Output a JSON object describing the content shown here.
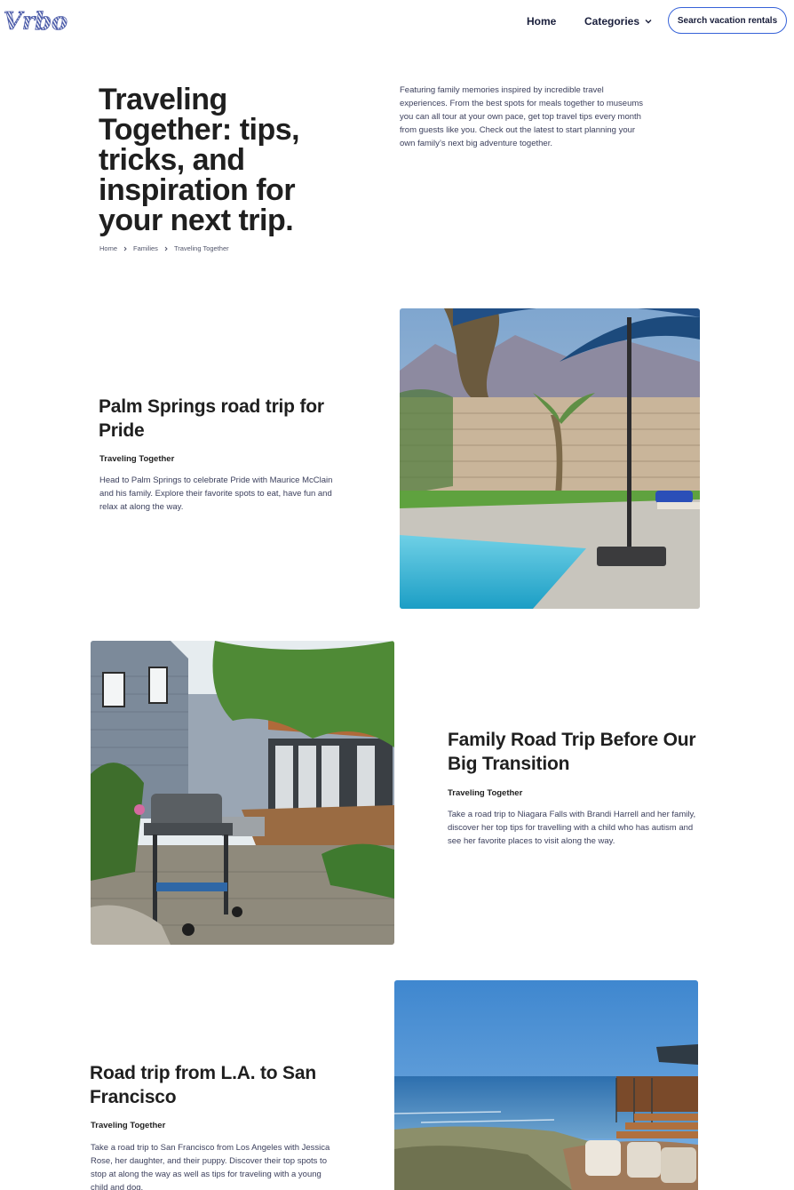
{
  "header": {
    "logo_text": "Vrbo",
    "nav_home": "Home",
    "nav_categories": "Categories",
    "search_button": "Search vacation rentals"
  },
  "hero": {
    "title": "Traveling Together: tips, tricks, and inspiration for your next trip.",
    "description": "Featuring family memories inspired by incredible travel experiences. From the best spots for meals together to museums you can all tour at your own pace, get top travel tips every month from guests like you. Check out the latest to start planning your own family’s next big adventure together.",
    "breadcrumb": [
      "Home",
      "Families",
      "Traveling Together"
    ]
  },
  "articles": [
    {
      "title": "Palm Springs road trip for Pride",
      "category": "Traveling Together",
      "description": "Head to Palm Springs to celebrate Pride with Maurice McClain and his family. Explore their favorite spots to eat, have fun and relax at along the way.",
      "image_subject": "pool-with-umbrella"
    },
    {
      "title": "Family Road Trip Before Our Big Transition",
      "category": "Traveling Together",
      "description": "Take a road trip to Niagara Falls with Brandi Harrell and her family, discover her top tips for travelling with a child who has autism and see her favorite places to visit along the way.",
      "image_subject": "backyard-grill"
    },
    {
      "title": "Road trip from L.A. to San Francisco",
      "category": "Traveling Together",
      "description": "Take a road trip to San Francisco from Los Angeles with Jessica Rose, her daughter, and their puppy. Discover their top spots to stop at along the way as well as tips for traveling with a young child and dog.",
      "image_subject": "ocean-view-deck"
    }
  ],
  "colors": {
    "brand_blue": "#3662d8",
    "text_dark": "#1f1f1f",
    "text_body": "#3b3f5c"
  }
}
